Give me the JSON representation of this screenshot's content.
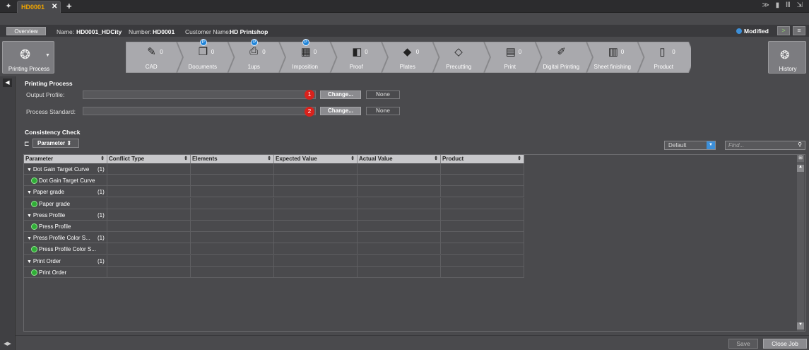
{
  "tab": {
    "title": "HD0001",
    "close": "✕",
    "add": "+"
  },
  "window_icons": "≫ ▮ Ⅲ ⇲",
  "info": {
    "overview": "Overview",
    "name_label": "Name:",
    "name_value": "HD0001_HDCity",
    "number_label": "Number:",
    "number_value": "HD0001",
    "customer_label": "Customer Name:",
    "customer_value": "HD Printshop",
    "status": "Modified"
  },
  "workflow": {
    "current": "Printing Process",
    "history": "History",
    "steps": [
      {
        "label": "CAD",
        "count": "0",
        "icon": "cad-icon",
        "blue": ""
      },
      {
        "label": "Documents",
        "count": "0",
        "icon": "documents-icon",
        "blue": "P"
      },
      {
        "label": "1ups",
        "count": "0",
        "icon": "pdf-icon",
        "blue": "P"
      },
      {
        "label": "Imposition",
        "count": "0",
        "icon": "imposition-icon",
        "blue": "P"
      },
      {
        "label": "Proof",
        "count": "0",
        "icon": "proof-icon",
        "blue": ""
      },
      {
        "label": "Plates",
        "count": "0",
        "icon": "plates-icon",
        "blue": ""
      },
      {
        "label": "Precutting",
        "count": "",
        "icon": "precutting-icon",
        "blue": ""
      },
      {
        "label": "Print",
        "count": "0",
        "icon": "print-icon",
        "blue": ""
      },
      {
        "label": "Digital Printing",
        "count": "",
        "icon": "digital-printing-icon",
        "blue": ""
      },
      {
        "label": "Sheet finishing",
        "count": "0",
        "icon": "sheet-finishing-icon",
        "blue": ""
      },
      {
        "label": "Product",
        "count": "0",
        "icon": "product-icon",
        "blue": ""
      }
    ]
  },
  "printing_process": {
    "title": "Printing Process",
    "output_profile_label": "Output Profile:",
    "process_standard_label": "Process Standard:",
    "badge1": "1",
    "badge2": "2",
    "change": "Change...",
    "none": "None"
  },
  "consistency": {
    "title": "Consistency Check",
    "group_by": "Parameter",
    "filter": "Default",
    "find_placeholder": "Find...",
    "columns": [
      "Parameter",
      "Conflict Type",
      "Elements",
      "Expected Value",
      "Actual Value",
      "Product"
    ],
    "rows": [
      {
        "type": "group",
        "text": "Dot Gain Target Curve",
        "count": "(1)"
      },
      {
        "type": "item",
        "text": "Dot Gain Target Curve"
      },
      {
        "type": "group",
        "text": "Paper grade",
        "count": "(1)"
      },
      {
        "type": "item",
        "text": "Paper grade"
      },
      {
        "type": "group",
        "text": "Press Profile",
        "count": "(1)"
      },
      {
        "type": "item",
        "text": "Press Profile"
      },
      {
        "type": "group",
        "text": "Press Profile Color S...",
        "count": "(1)"
      },
      {
        "type": "item",
        "text": "Press Profile Color S..."
      },
      {
        "type": "group",
        "text": "Print Order",
        "count": "(1)"
      },
      {
        "type": "item",
        "text": "Print Order"
      }
    ]
  },
  "footer": {
    "save": "Save",
    "close_job": "Close Job"
  },
  "colors": {
    "accent": "#f0a500",
    "badge": "#d9221c",
    "ok": "#2fae36",
    "info": "#3d8fd8"
  }
}
